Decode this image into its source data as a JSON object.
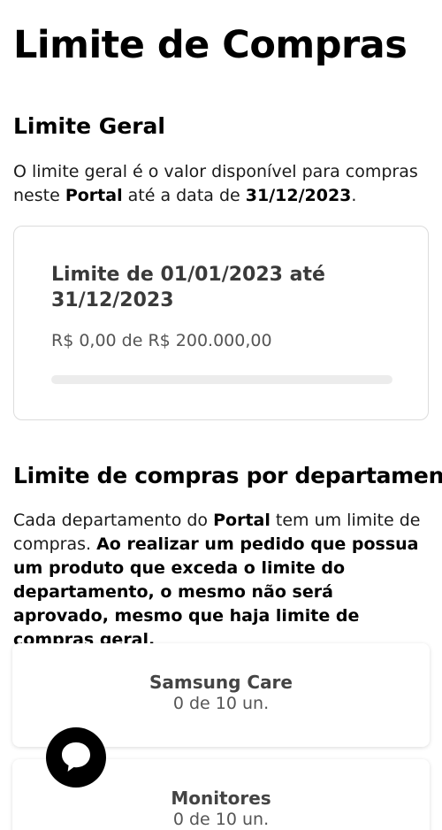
{
  "page": {
    "title": "Limite de Compras"
  },
  "general": {
    "title": "Limite Geral",
    "desc_part1": "O limite geral é o valor disponível para compras neste ",
    "desc_bold1": "Portal",
    "desc_part2": " até a data de ",
    "desc_bold2": "31/12/2023",
    "desc_part3": ".",
    "card": {
      "title": "Limite de 01/01/2023 até 31/12/2023",
      "value_text": "R$ 0,00 de R$ 200.000,00",
      "used_fraction": 0.0
    }
  },
  "departments": {
    "title": "Limite de compras por departamento",
    "desc_part1": "Cada departamento do ",
    "desc_bold1": "Portal",
    "desc_part2": " tem um limite de compras. ",
    "desc_bold2": "Ao realizar um pedido que possua um produto que exceda o limite do departamento, o mesmo não será aprovado, mesmo que haja limite de compras geral.",
    "items": [
      {
        "name": "Samsung Care",
        "count": "0 de 10 un."
      },
      {
        "name": "Monitores",
        "count": "0 de 10 un."
      }
    ]
  },
  "chat": {
    "icon": "chat-bubble-icon"
  },
  "colors": {
    "progress_fill": "#1428a0",
    "progress_track": "#ececec"
  }
}
